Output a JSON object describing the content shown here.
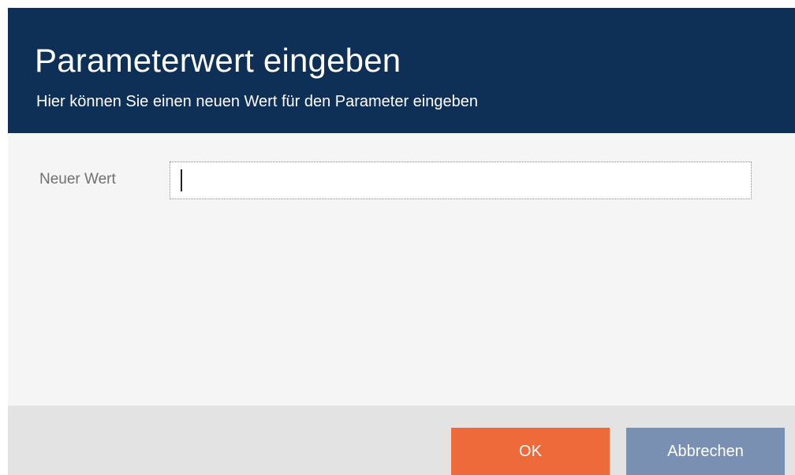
{
  "dialog": {
    "title": "Parameterwert eingeben",
    "subtitle": "Hier können Sie einen neuen Wert für den Parameter eingeben"
  },
  "form": {
    "new_value_label": "Neuer Wert",
    "new_value": "",
    "new_value_placeholder": ""
  },
  "buttons": {
    "ok_label": "OK",
    "cancel_label": "Abbrechen"
  },
  "colors": {
    "header_background": "#0e2f56",
    "ok_button": "#ef6a3a",
    "cancel_button": "#7990b2"
  }
}
